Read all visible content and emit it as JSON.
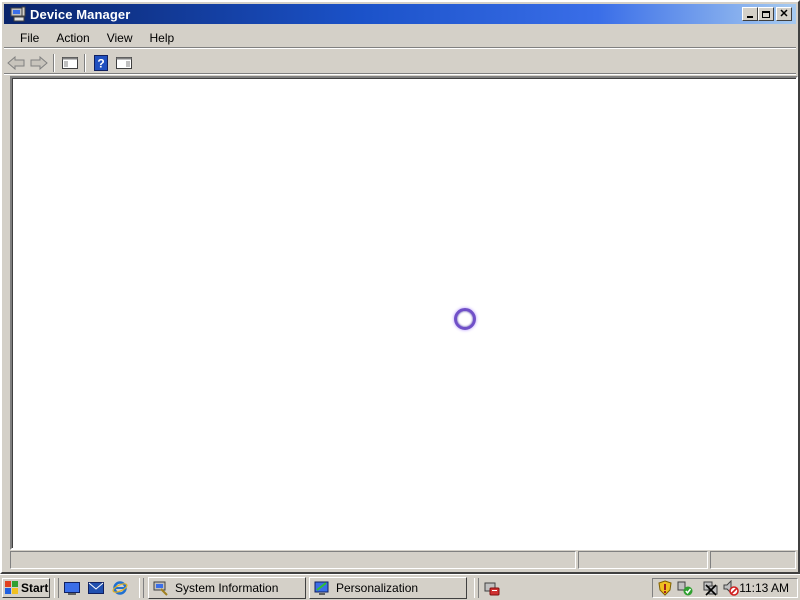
{
  "window": {
    "title": "Device Manager",
    "icon": "device-manager-icon",
    "controls": [
      "minimize",
      "maximize",
      "close"
    ]
  },
  "menu": {
    "items": [
      "File",
      "Action",
      "View",
      "Help"
    ]
  },
  "toolbar": {
    "buttons": [
      "back-icon",
      "forward-icon",
      "show-hide-console-tree-icon",
      "help-icon",
      "show-hide-action-pane-icon"
    ]
  },
  "taskbar": {
    "start_label": "Start",
    "quick_launch": [
      "show-desktop-icon",
      "outlook-icon",
      "internet-explorer-icon"
    ],
    "tasks": [
      {
        "label": "System Information",
        "icon": "system-information-icon"
      },
      {
        "label": "Personalization",
        "icon": "personalization-icon"
      }
    ],
    "tray_icons": [
      "security-shield-icon",
      "network-ok-icon",
      "network-disconnected-icon",
      "volume-muted-icon"
    ],
    "clock": "11:13 AM"
  },
  "colors": {
    "titlebar_start": "#0a246a",
    "titlebar_end": "#a6caf0",
    "face": "#d4d0c8"
  }
}
